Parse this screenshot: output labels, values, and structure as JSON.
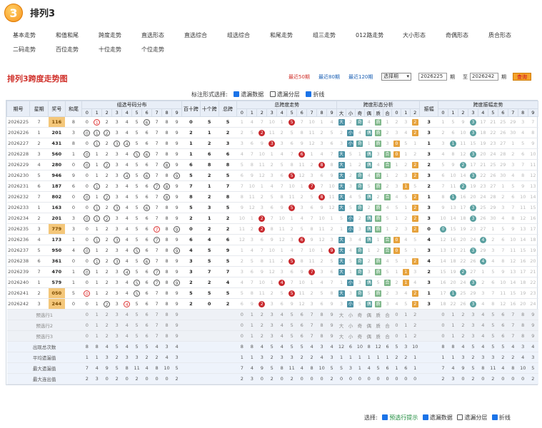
{
  "app": {
    "title": "排列3",
    "logo_text": "3"
  },
  "nav": [
    "基本走势",
    "和值和尾",
    "跨度走势",
    "直选形态",
    "直选综合",
    "组选综合",
    "和尾走势",
    "组三走势",
    "012路走势",
    "大小形态",
    "奇偶形态",
    "质合形态",
    "二码走势",
    "百位走势",
    "十位走势",
    "个位走势"
  ],
  "section": {
    "title": "排列3跨度走势图"
  },
  "controls": {
    "recent50": "最近50期",
    "recent80": "最近80期",
    "recent120": "最近120期",
    "select_label": "选择期",
    "from_issue": "2026225",
    "period_label": "期",
    "to_label": "至",
    "to_issue": "2026242",
    "period_label2": "期",
    "query": "查询"
  },
  "mark": {
    "label": "标注形式选择:",
    "opt1": "遗漏数据",
    "opt2": "遗漏分层",
    "opt3": "折线"
  },
  "headers": {
    "issue": "期号",
    "week": "星期",
    "prize": "奖号",
    "sum": "和尾",
    "group_dist": "组选号码分布",
    "hundred_ten": "百十跨",
    "ten_one": "十个跨",
    "total_span": "总跨",
    "span_trend": "总跨度走势",
    "span_form": "跨度形态分析",
    "amp": "振幅",
    "amp_trend": "跨度振幅走势",
    "big": "大",
    "small": "小",
    "odd": "奇",
    "even": "偶",
    "prime": "质",
    "comp": "合",
    "d0": "0",
    "d1": "1",
    "d2": "2"
  },
  "digits": [
    "0",
    "1",
    "2",
    "3",
    "4",
    "5",
    "6",
    "7",
    "8",
    "9"
  ],
  "rows": [
    {
      "issue": "2026225",
      "week": "7",
      "prize": "116",
      "sum": "8",
      "hs": "0",
      "to": "5",
      "span": "5",
      "amp": "3"
    },
    {
      "issue": "2026226",
      "week": "1",
      "prize": "201",
      "sum": "3",
      "hs": "2",
      "to": "1",
      "span": "2",
      "amp": "3"
    },
    {
      "issue": "2026227",
      "week": "2",
      "prize": "431",
      "sum": "8",
      "hs": "1",
      "to": "2",
      "span": "3",
      "amp": "1"
    },
    {
      "issue": "2026228",
      "week": "3",
      "prize": "560",
      "sum": "1",
      "hs": "1",
      "to": "6",
      "span": "6",
      "amp": "3"
    },
    {
      "issue": "2026229",
      "week": "4",
      "prize": "280",
      "sum": "0",
      "hs": "6",
      "to": "8",
      "span": "8",
      "amp": "2"
    },
    {
      "issue": "2026230",
      "week": "5",
      "prize": "946",
      "sum": "9",
      "hs": "5",
      "to": "2",
      "span": "5",
      "amp": "3"
    },
    {
      "issue": "2026231",
      "week": "6",
      "prize": "187",
      "sum": "6",
      "hs": "7",
      "to": "1",
      "span": "7",
      "amp": "2"
    },
    {
      "issue": "2026232",
      "week": "7",
      "prize": "802",
      "sum": "0",
      "hs": "8",
      "to": "2",
      "span": "8",
      "amp": "1"
    },
    {
      "issue": "2026233",
      "week": "1",
      "prize": "163",
      "sum": "0",
      "hs": "5",
      "to": "3",
      "span": "5",
      "amp": "3"
    },
    {
      "issue": "2026234",
      "week": "2",
      "prize": "201",
      "sum": "3",
      "hs": "2",
      "to": "1",
      "span": "2",
      "amp": "3"
    },
    {
      "issue": "2026235",
      "week": "3",
      "prize": "779",
      "sum": "3",
      "hs": "0",
      "to": "2",
      "span": "2",
      "amp": "0"
    },
    {
      "issue": "2026236",
      "week": "4",
      "prize": "173",
      "sum": "1",
      "hs": "6",
      "to": "4",
      "span": "6",
      "amp": "4"
    },
    {
      "issue": "2026237",
      "week": "5",
      "prize": "950",
      "sum": "4",
      "hs": "4",
      "to": "5",
      "span": "9",
      "amp": "3"
    },
    {
      "issue": "2026238",
      "week": "6",
      "prize": "361",
      "sum": "0",
      "hs": "3",
      "to": "5",
      "span": "5",
      "amp": "4"
    },
    {
      "issue": "2026239",
      "week": "7",
      "prize": "470",
      "sum": "1",
      "hs": "3",
      "to": "7",
      "span": "7",
      "amp": "2"
    },
    {
      "issue": "2026240",
      "week": "1",
      "prize": "579",
      "sum": "1",
      "hs": "2",
      "to": "2",
      "span": "4",
      "amp": "3"
    },
    {
      "issue": "2026241",
      "week": "2",
      "prize": "050",
      "sum": "5",
      "hs": "5",
      "to": "5",
      "span": "5",
      "amp": "1"
    },
    {
      "issue": "2026242",
      "week": "3",
      "prize": "244",
      "sum": "0",
      "hs": "2",
      "to": "0",
      "span": "2",
      "amp": "3"
    }
  ],
  "pred": [
    "预选行1",
    "预选行2",
    "预选行3"
  ],
  "stats": [
    {
      "label": "出现总次数",
      "vals": [
        "8",
        "8",
        "4",
        "5",
        "4",
        "5",
        "5",
        "4",
        "3",
        "4",
        "12",
        "6",
        "10",
        "8",
        "12",
        "6",
        "5",
        "3",
        "10"
      ]
    },
    {
      "label": "平均遗漏值",
      "vals": [
        "1",
        "1",
        "3",
        "2",
        "3",
        "3",
        "2",
        "2",
        "4",
        "3",
        "1",
        "1",
        "1",
        "1",
        "1",
        "1",
        "2",
        "2",
        "1"
      ]
    },
    {
      "label": "最大遗漏值",
      "vals": [
        "7",
        "4",
        "9",
        "5",
        "8",
        "11",
        "4",
        "8",
        "10",
        "5",
        "5",
        "3",
        "1",
        "4",
        "5",
        "6",
        "1",
        "6",
        "1"
      ]
    },
    {
      "label": "最大连出值",
      "vals": [
        "2",
        "3",
        "0",
        "2",
        "0",
        "2",
        "0",
        "0",
        "0",
        "2",
        "0",
        "0",
        "0",
        "0",
        "0",
        "0",
        "0",
        "0",
        "0"
      ]
    }
  ],
  "bottom": {
    "label": "选择:",
    "opt1": "预选行提示",
    "opt2": "遗漏数据",
    "opt3": "遗漏分层",
    "opt4": "折线"
  }
}
